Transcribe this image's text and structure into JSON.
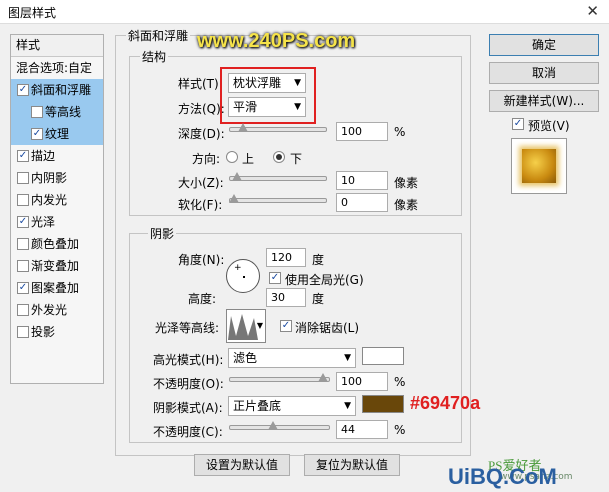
{
  "window": {
    "title": "图层样式"
  },
  "watermark": {
    "url": "www.240PS.com",
    "footer_brand": "UiBQ.CoM",
    "footer_site": "www.psahz.com",
    "footer_script": "PS爱好者"
  },
  "sidebar": {
    "header": "样式",
    "items": [
      {
        "label": "混合选项:自定",
        "check": null,
        "sel": false,
        "sub": false
      },
      {
        "label": "斜面和浮雕",
        "check": true,
        "sel": true,
        "sub": false
      },
      {
        "label": "等高线",
        "check": false,
        "sel": true,
        "sub": true
      },
      {
        "label": "纹理",
        "check": true,
        "sel": true,
        "sub": true
      },
      {
        "label": "描边",
        "check": true,
        "sel": false,
        "sub": false
      },
      {
        "label": "内阴影",
        "check": false,
        "sel": false,
        "sub": false
      },
      {
        "label": "内发光",
        "check": false,
        "sel": false,
        "sub": false
      },
      {
        "label": "光泽",
        "check": true,
        "sel": false,
        "sub": false
      },
      {
        "label": "颜色叠加",
        "check": false,
        "sel": false,
        "sub": false
      },
      {
        "label": "渐变叠加",
        "check": false,
        "sel": false,
        "sub": false
      },
      {
        "label": "图案叠加",
        "check": true,
        "sel": false,
        "sub": false
      },
      {
        "label": "外发光",
        "check": false,
        "sel": false,
        "sub": false
      },
      {
        "label": "投影",
        "check": false,
        "sel": false,
        "sub": false
      }
    ]
  },
  "bevel": {
    "title": "斜面和浮雕",
    "structure": {
      "title": "结构",
      "style_label": "样式(T):",
      "style_value": "枕状浮雕",
      "technique_label": "方法(Q):",
      "technique_value": "平滑",
      "depth_label": "深度(D):",
      "depth_value": "100",
      "depth_unit": "%",
      "depth_level": 0.1,
      "direction_label": "方向:",
      "direction_up": "上",
      "direction_down": "下",
      "direction_selected": "下",
      "size_label": "大小(Z):",
      "size_value": "10",
      "size_unit": "像素",
      "size_level": 0.04,
      "soften_label": "软化(F):",
      "soften_value": "0",
      "soften_unit": "像素",
      "soften_level": 0
    },
    "shading": {
      "title": "阴影",
      "angle_label": "角度(N):",
      "angle_value": "120",
      "angle_unit": "度",
      "global_light_label": "使用全局光(G)",
      "global_light": true,
      "altitude_label": "高度:",
      "altitude_value": "30",
      "altitude_unit": "度",
      "gloss_label": "光泽等高线:",
      "antialias_label": "消除锯齿(L)",
      "antialias": true,
      "highlight_mode_label": "高光模式(H):",
      "highlight_mode": "滤色",
      "highlight_color": "#ffffff",
      "highlight_opacity_label": "不透明度(O):",
      "highlight_opacity": "100",
      "highlight_opacity_unit": "%",
      "highlight_level": 1.0,
      "shadow_mode_label": "阴影模式(A):",
      "shadow_mode": "正片叠底",
      "shadow_color": "#69470a",
      "shadow_color_annotation": "#69470a",
      "shadow_opacity_label": "不透明度(C):",
      "shadow_opacity": "44",
      "shadow_opacity_unit": "%",
      "shadow_level": 0.44
    },
    "make_default": "设置为默认值",
    "reset_default": "复位为默认值"
  },
  "right": {
    "ok": "确定",
    "cancel": "取消",
    "new_style": "新建样式(W)...",
    "preview_label": "预览(V)",
    "preview": true
  }
}
